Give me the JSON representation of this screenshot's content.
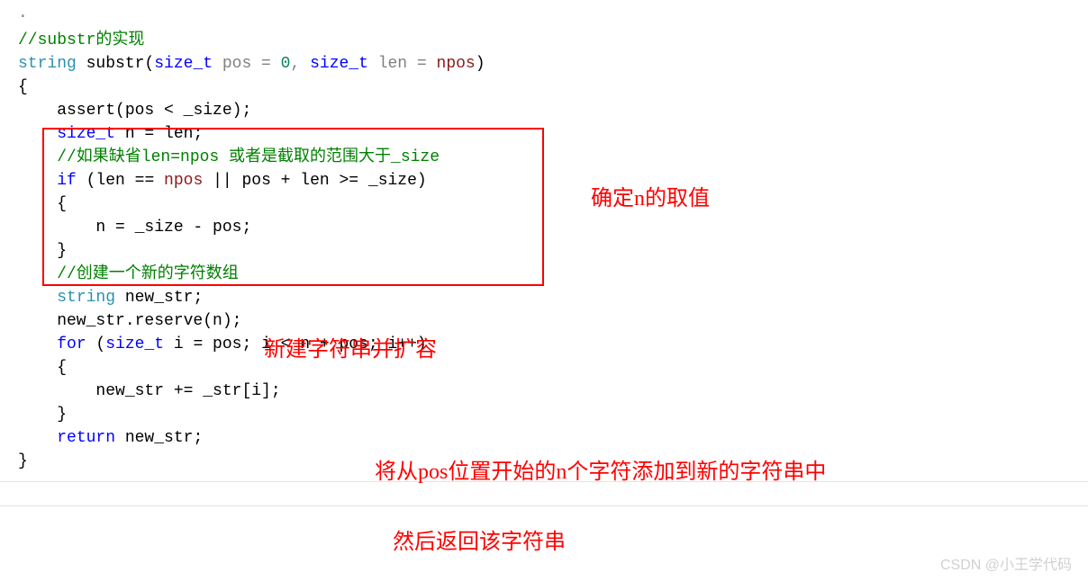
{
  "code": {
    "l0": "·",
    "l1": "//substr的实现",
    "l2a": "string",
    "l2b": " substr(",
    "l2c": "size_t",
    "l2d": " pos = ",
    "l2e": "0",
    "l2f": ", ",
    "l2g": "size_t",
    "l2h": " len = ",
    "l2i": "npos",
    "l2j": ")",
    "l3": "{",
    "l4a": "    assert",
    "l4b": "(pos < _size);",
    "l5": "",
    "l6a": "    ",
    "l6b": "size_t",
    "l6c": " n = len;",
    "l7": "    //如果缺省len=npos 或者是截取的范围大于_size",
    "l8a": "    ",
    "l8b": "if",
    "l8c": " (len == ",
    "l8d": "npos",
    "l8e": " || pos + len >= _size)",
    "l9": "    {",
    "l10": "        n = _size - pos;",
    "l11": "    }",
    "l12": "    //创建一个新的字符数组",
    "l13a": "    ",
    "l13b": "string",
    "l13c": " new_str;",
    "l14": "    new_str.reserve(n);",
    "l15": "",
    "l16a": "    ",
    "l16b": "for",
    "l16c": " (",
    "l16d": "size_t",
    "l16e": " i = pos; i < n + pos; i++)",
    "l17": "    {",
    "l18": "        new_str += _str[i];",
    "l19": "    }",
    "l20a": "    ",
    "l20b": "return",
    "l20c": " new_str;",
    "l21": "}"
  },
  "annotations": {
    "a1": "确定n的取值",
    "a2": "新建字符串并扩容",
    "a3": "将从pos位置开始的n个字符添加到新的字符串中",
    "a4": "然后返回该字符串"
  },
  "watermark": "CSDN @小王学代码"
}
